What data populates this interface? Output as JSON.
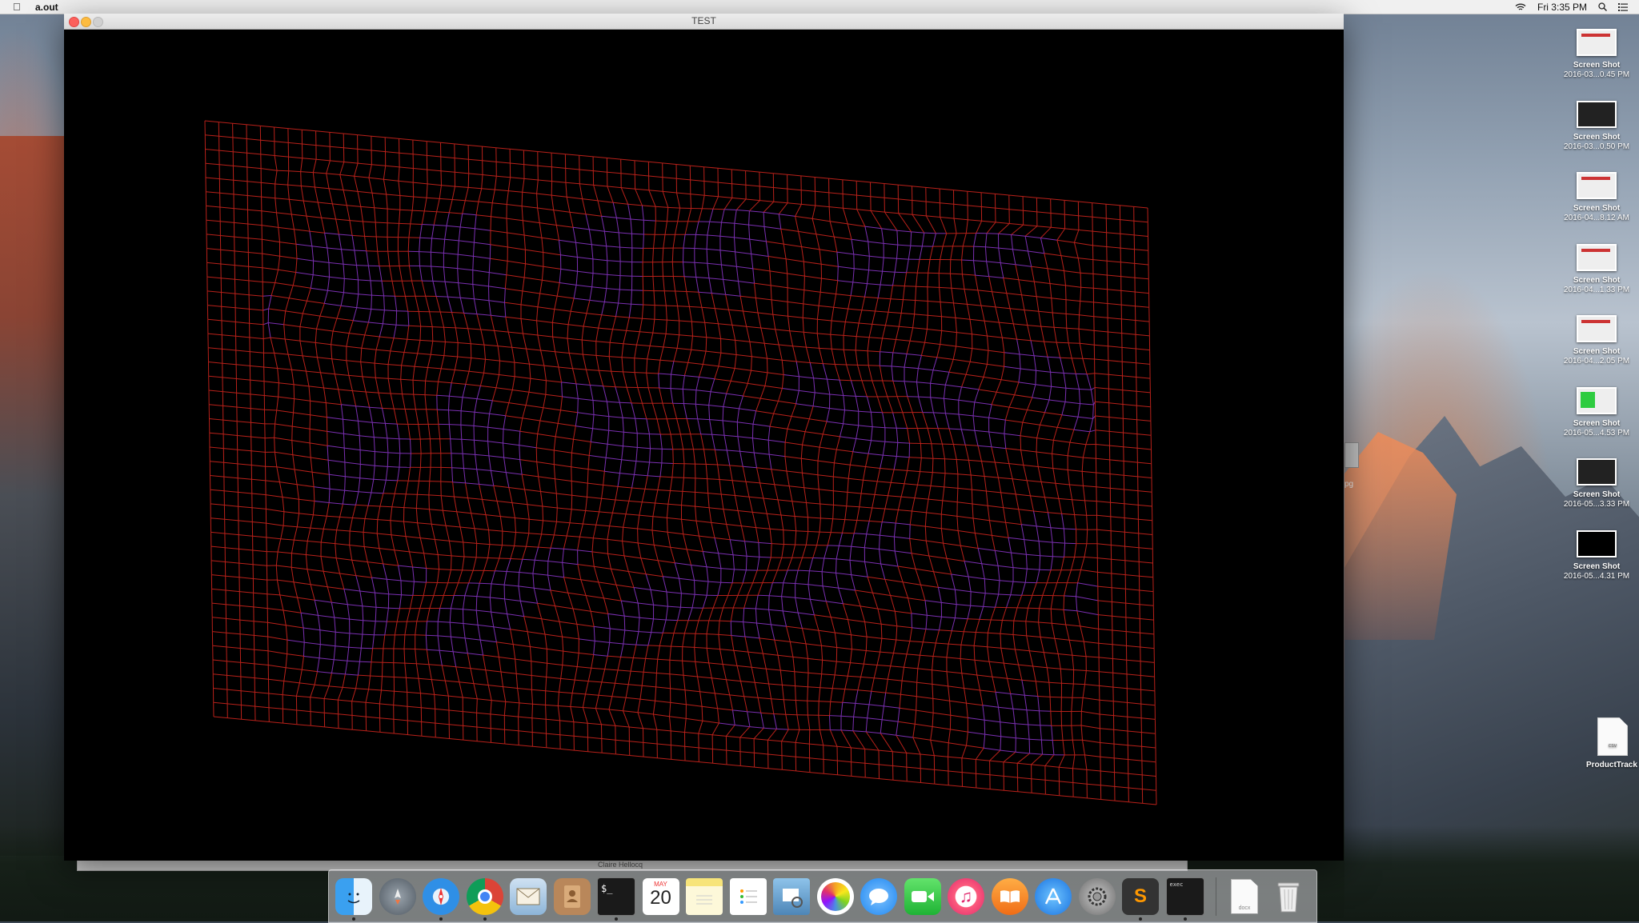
{
  "menubar": {
    "app_name": "a.out",
    "clock": "Fri 3:35 PM",
    "icons": [
      "apple-icon",
      "wifi-icon",
      "spotlight-search-icon",
      "notification-center-icon"
    ]
  },
  "window": {
    "title": "TEST",
    "canvas_background": "#000000",
    "grid_color": "#b8211a",
    "wave_color": "#7a2fb0"
  },
  "background_window": {
    "text": "Claire Hellocq"
  },
  "background_edge": {
    "label": "pg"
  },
  "desktop_icons": [
    {
      "name": "Screen Shot",
      "date": "2016-03...0.45 PM",
      "style": "light"
    },
    {
      "name": "Screen Shot",
      "date": "2016-03...0.50 PM",
      "style": "dark"
    },
    {
      "name": "Screen Shot",
      "date": "2016-04...8.12 AM",
      "style": "light"
    },
    {
      "name": "Screen Shot",
      "date": "2016-04...1.33 PM",
      "style": "light"
    },
    {
      "name": "Screen Shot",
      "date": "2016-04...2.05 PM",
      "style": "light"
    },
    {
      "name": "Screen Shot",
      "date": "2016-05...4.53 PM",
      "style": "green"
    },
    {
      "name": "Screen Shot",
      "date": "2016-05...3.33 PM",
      "style": "dark"
    },
    {
      "name": "Screen Shot",
      "date": "2016-05...4.31 PM",
      "style": "black"
    }
  ],
  "desktop_file": {
    "name": "ProductTrack",
    "ext": "csv"
  },
  "dock": {
    "calendar_month": "MAY",
    "calendar_day": "20",
    "docx_ext": "docx",
    "items": [
      "finder-icon",
      "launchpad-icon",
      "safari-icon",
      "chrome-icon",
      "mail-icon",
      "contacts-icon",
      "terminal-icon",
      "calendar-icon",
      "notes-icon",
      "reminders-icon",
      "preview-icon",
      "photos-icon",
      "messages-icon",
      "facetime-icon",
      "itunes-icon",
      "ibooks-icon",
      "app-store-icon",
      "system-preferences-icon",
      "sublime-text-icon",
      "exec-icon",
      "docx-file-icon",
      "trash-icon"
    ]
  }
}
